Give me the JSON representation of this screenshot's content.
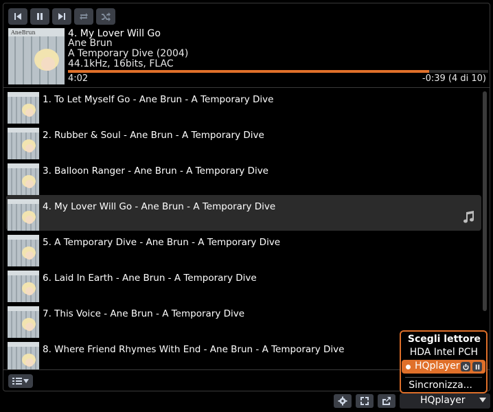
{
  "controls": {
    "prev": "skip-back-icon",
    "pause": "pause-icon",
    "next": "skip-forward-icon",
    "repeat": "repeat-icon",
    "shuffle": "shuffle-icon"
  },
  "now_playing": {
    "cover_text": "AneBrun",
    "title": "4. My Lover Will Go",
    "artist": "Ane Brun",
    "album": "A Temporary Dive (2004)",
    "tech": "44.1kHz, 16bits, FLAC",
    "elapsed": "4:02",
    "remaining": "-0:39  (4 di 10)",
    "progress": 0.86
  },
  "playlist": [
    {
      "label": "1. To Let Myself Go - Ane Brun - A Temporary Dive"
    },
    {
      "label": "2. Rubber & Soul - Ane Brun - A Temporary Dive"
    },
    {
      "label": "3. Balloon Ranger - Ane Brun - A Temporary Dive"
    },
    {
      "label": "4. My Lover Will Go - Ane Brun - A Temporary Dive",
      "current": true
    },
    {
      "label": "5. A Temporary Dive - Ane Brun - A Temporary Dive"
    },
    {
      "label": "6. Laid In Earth - Ane Brun - A Temporary Dive"
    },
    {
      "label": "7. This Voice - Ane Brun - A Temporary Dive"
    },
    {
      "label": "8. Where Friend Rhymes With End - Ane Brun - A Temporary Dive"
    }
  ],
  "player_popup": {
    "title": "Scegli lettore",
    "items": [
      "HDA Intel PCH",
      "HQplayer"
    ],
    "active": "HQplayer",
    "sync": "Sincronizza..."
  },
  "player_select": {
    "value": "HQplayer"
  },
  "colors": {
    "accent": "#e0702a",
    "button": "#3b3f47",
    "background": "#000000"
  }
}
